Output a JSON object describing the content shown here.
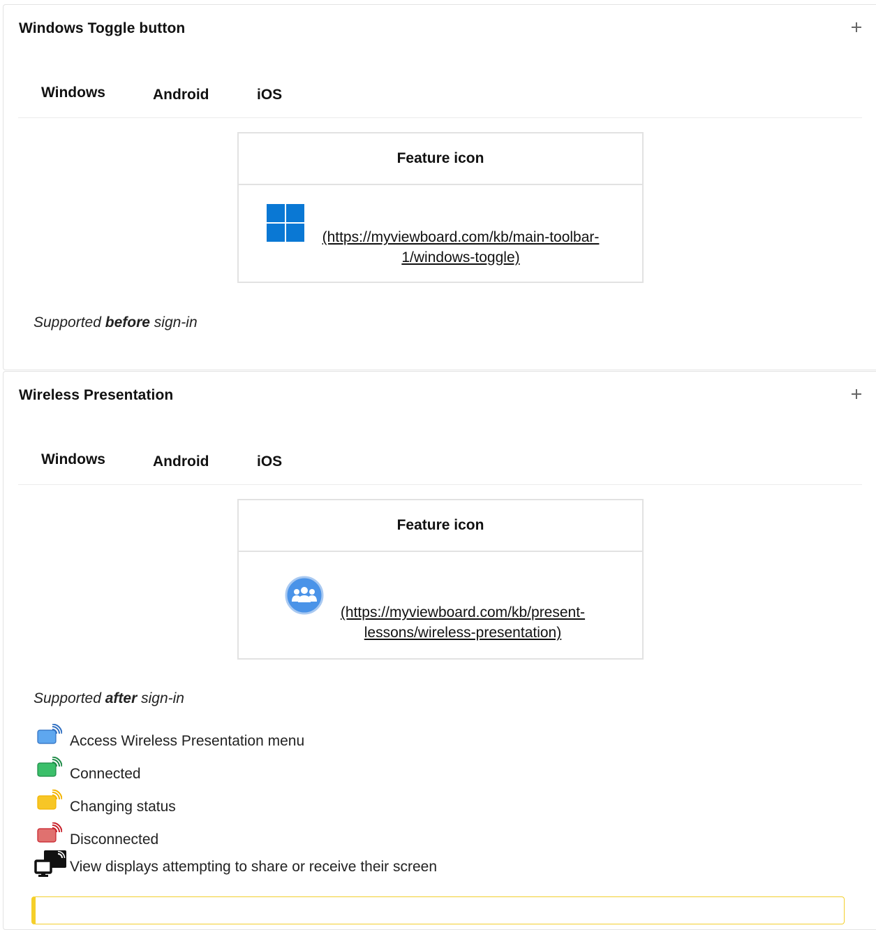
{
  "sections": [
    {
      "title": "Windows Toggle button",
      "tabs": [
        "Windows",
        "Android",
        "iOS"
      ],
      "table_header": "Feature icon",
      "link_text": "(https://myviewboard.com/kb/main-toolbar-1/windows-toggle)",
      "icon": "windows-logo-icon",
      "note_prefix": "Supported ",
      "note_emphasis": "before",
      "note_suffix": " sign-in"
    },
    {
      "title": "Wireless Presentation",
      "tabs": [
        "Windows",
        "Android",
        "iOS"
      ],
      "table_header": "Feature icon",
      "link_text": "(https://myviewboard.com/kb/present-lessons/wireless-presentation)",
      "icon": "people-group-icon",
      "note_prefix": "Supported ",
      "note_emphasis": "after",
      "note_suffix": " sign-in",
      "statuses": [
        {
          "label": "Access Wireless Presentation menu",
          "icon": "cast-blue-icon",
          "color": "#5ea7ef",
          "wave": "#2f6fc1"
        },
        {
          "label": "Connected",
          "icon": "cast-green-icon",
          "color": "#3bbf6a",
          "wave": "#1d8a46"
        },
        {
          "label": "Changing status",
          "icon": "cast-yellow-icon",
          "color": "#f7c626",
          "wave": "#f3b400"
        },
        {
          "label": "Disconnected",
          "icon": "cast-red-icon",
          "color": "#e0716f",
          "wave": "#c8202a"
        },
        {
          "label": "View displays attempting to share or receive their screen",
          "icon": "display-share-icon",
          "color": "#111111",
          "wave": "#111111"
        }
      ]
    }
  ],
  "colors": {
    "windows_blue": "#0a78d4",
    "people_blue": "#4a93e8",
    "callout_yellow": "#f5cf2a"
  }
}
